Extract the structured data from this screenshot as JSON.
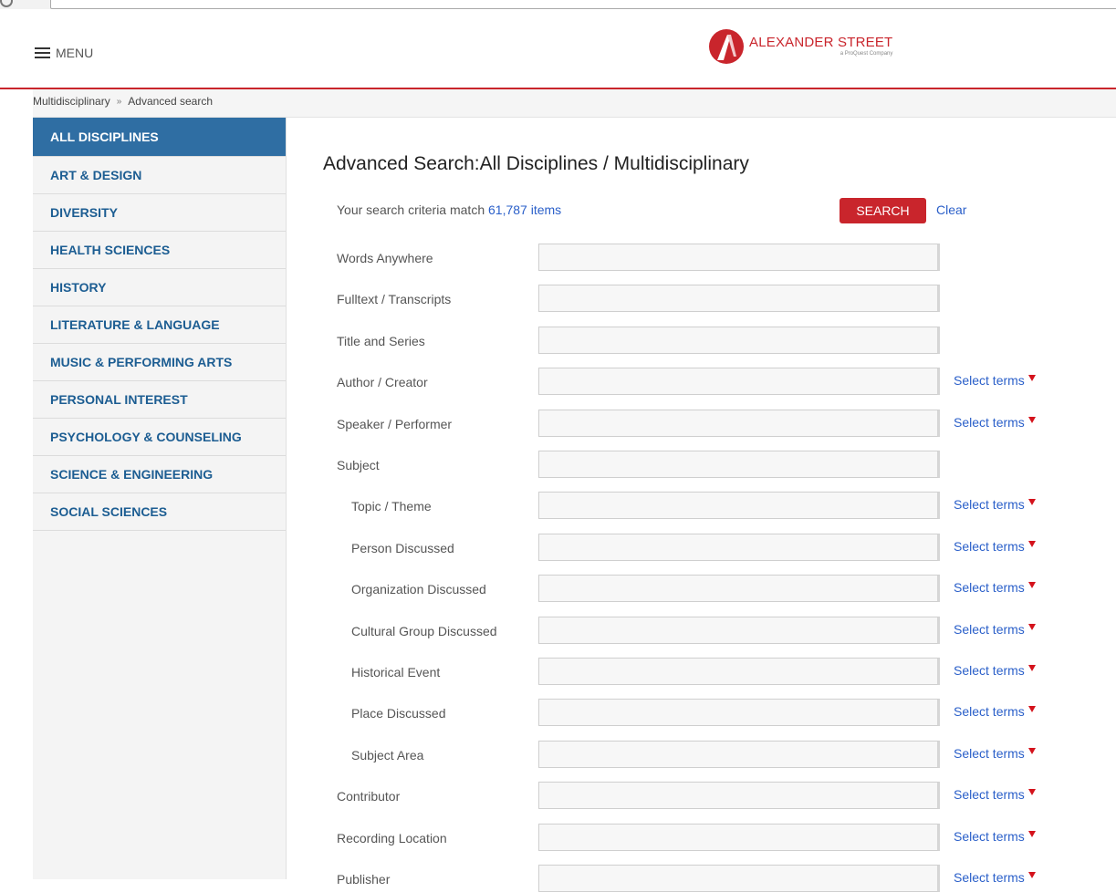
{
  "header": {
    "menu_label": "MENU",
    "logo_name": "ALEXANDER STREET",
    "logo_sub": "a ProQuest Company",
    "brand_color": "#c9252c"
  },
  "breadcrumb": {
    "items": [
      "Multidisciplinary",
      "Advanced search"
    ],
    "separator": "»"
  },
  "sidebar": {
    "items": [
      {
        "label": "ALL DISCIPLINES",
        "active": true
      },
      {
        "label": "ART & DESIGN"
      },
      {
        "label": "DIVERSITY"
      },
      {
        "label": "HEALTH SCIENCES"
      },
      {
        "label": "HISTORY"
      },
      {
        "label": "LITERATURE & LANGUAGE"
      },
      {
        "label": "MUSIC & PERFORMING ARTS"
      },
      {
        "label": "PERSONAL INTEREST"
      },
      {
        "label": "PSYCHOLOGY & COUNSELING"
      },
      {
        "label": "SCIENCE & ENGINEERING"
      },
      {
        "label": "SOCIAL SCIENCES"
      }
    ]
  },
  "main": {
    "title": "Advanced Search:All Disciplines / Multidisciplinary",
    "criteria_prefix": "Your search criteria match ",
    "criteria_count": "61,787 items",
    "search_label": "SEARCH",
    "clear_label": "Clear",
    "select_terms_label": "Select terms",
    "fields": [
      {
        "label": "Words Anywhere",
        "value": "",
        "select_terms": false,
        "sub": false
      },
      {
        "label": "Fulltext / Transcripts",
        "value": "",
        "select_terms": false,
        "sub": false
      },
      {
        "label": "Title and Series",
        "value": "",
        "select_terms": false,
        "sub": false
      },
      {
        "label": "Author / Creator",
        "value": "",
        "select_terms": true,
        "sub": false
      },
      {
        "label": "Speaker / Performer",
        "value": "",
        "select_terms": true,
        "sub": false
      },
      {
        "label": "Subject",
        "value": "",
        "select_terms": false,
        "sub": false
      },
      {
        "label": "Topic / Theme",
        "value": "",
        "select_terms": true,
        "sub": true
      },
      {
        "label": "Person Discussed",
        "value": "",
        "select_terms": true,
        "sub": true
      },
      {
        "label": "Organization Discussed",
        "value": "",
        "select_terms": true,
        "sub": true
      },
      {
        "label": "Cultural Group Discussed",
        "value": "",
        "select_terms": true,
        "sub": true
      },
      {
        "label": "Historical Event",
        "value": "",
        "select_terms": true,
        "sub": true
      },
      {
        "label": "Place Discussed",
        "value": "",
        "select_terms": true,
        "sub": true
      },
      {
        "label": "Subject Area",
        "value": "",
        "select_terms": true,
        "sub": true
      },
      {
        "label": "Contributor",
        "value": "",
        "select_terms": true,
        "sub": false
      },
      {
        "label": "Recording Location",
        "value": "",
        "select_terms": true,
        "sub": false
      },
      {
        "label": "Publisher",
        "value": "",
        "select_terms": true,
        "sub": false
      }
    ]
  }
}
